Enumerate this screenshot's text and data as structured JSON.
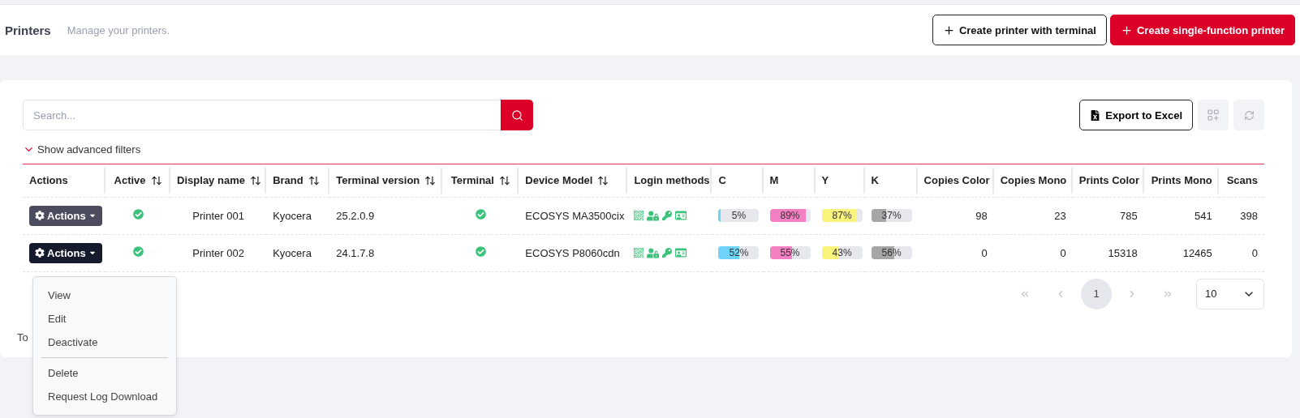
{
  "header": {
    "title": "Printers",
    "subtitle": "Manage your printers.",
    "buttons": [
      {
        "kind": "outline",
        "label": "Create printer with terminal"
      },
      {
        "kind": "primary",
        "label": "Create single-function printer"
      }
    ]
  },
  "search": {
    "placeholder": "Search..."
  },
  "toolbar": {
    "export_label": "Export to Excel"
  },
  "filters_toggle": {
    "label": "Show advanced filters",
    "expanded": false
  },
  "table": {
    "columns": [
      {
        "label": "Actions",
        "sortable": false
      },
      {
        "label": "Active",
        "sortable": true
      },
      {
        "label": "Display name",
        "sortable": true
      },
      {
        "label": "Brand",
        "sortable": true
      },
      {
        "label": "Terminal version",
        "sortable": true
      },
      {
        "label": "Terminal",
        "sortable": true
      },
      {
        "label": "Device Model",
        "sortable": true
      },
      {
        "label": "Login methods",
        "sortable": false
      },
      {
        "label": "C",
        "sortable": false
      },
      {
        "label": "M",
        "sortable": false
      },
      {
        "label": "Y",
        "sortable": false
      },
      {
        "label": "K",
        "sortable": false
      },
      {
        "label": "Copies Color",
        "sortable": false
      },
      {
        "label": "Copies Mono",
        "sortable": false
      },
      {
        "label": "Prints Color",
        "sortable": false
      },
      {
        "label": "Prints Mono",
        "sortable": false
      },
      {
        "label": "Scans",
        "sortable": false
      }
    ],
    "rows": [
      {
        "actions_label": "Actions",
        "menu_open": false,
        "active": true,
        "display_name": "Printer 001",
        "brand": "Kyocera",
        "terminal_version": "25.2.0.9",
        "terminal": true,
        "device_model": "ECOSYS MA3500cix",
        "inks": [
          {
            "color": "#6dd3f7",
            "level": 0.05,
            "reading": "5%"
          },
          {
            "color": "#f47fc3",
            "level": 0.89,
            "reading": "89%"
          },
          {
            "color": "#fbf47c",
            "level": 0.87,
            "reading": "87%"
          },
          {
            "color": "#a6a6a6",
            "level": 0.37,
            "reading": "37%"
          }
        ],
        "counts": [
          "98",
          "23",
          "785",
          "541",
          "398"
        ]
      },
      {
        "actions_label": "Actions",
        "menu_open": true,
        "active": true,
        "display_name": "Printer 002",
        "brand": "Kyocera",
        "terminal_version": "24.1.7.8",
        "terminal": true,
        "device_model": "ECOSYS P8060cdn",
        "inks": [
          {
            "color": "#6dd3f7",
            "level": 0.52,
            "reading": "52%"
          },
          {
            "color": "#f47fc3",
            "level": 0.55,
            "reading": "55%"
          },
          {
            "color": "#fbf47c",
            "level": 0.43,
            "reading": "43%"
          },
          {
            "color": "#a6a6a6",
            "level": 0.56,
            "reading": "56%"
          }
        ],
        "counts": [
          "0",
          "0",
          "15318",
          "12465",
          "0"
        ]
      }
    ]
  },
  "actions_menu": {
    "groups": [
      [
        "View",
        "Edit",
        "Deactivate"
      ],
      [
        "Delete",
        "Request Log Download"
      ]
    ]
  },
  "footer_text": "To",
  "pagination": {
    "pages": [
      {
        "label": "1",
        "selected": true
      }
    ],
    "page_size": "10"
  }
}
